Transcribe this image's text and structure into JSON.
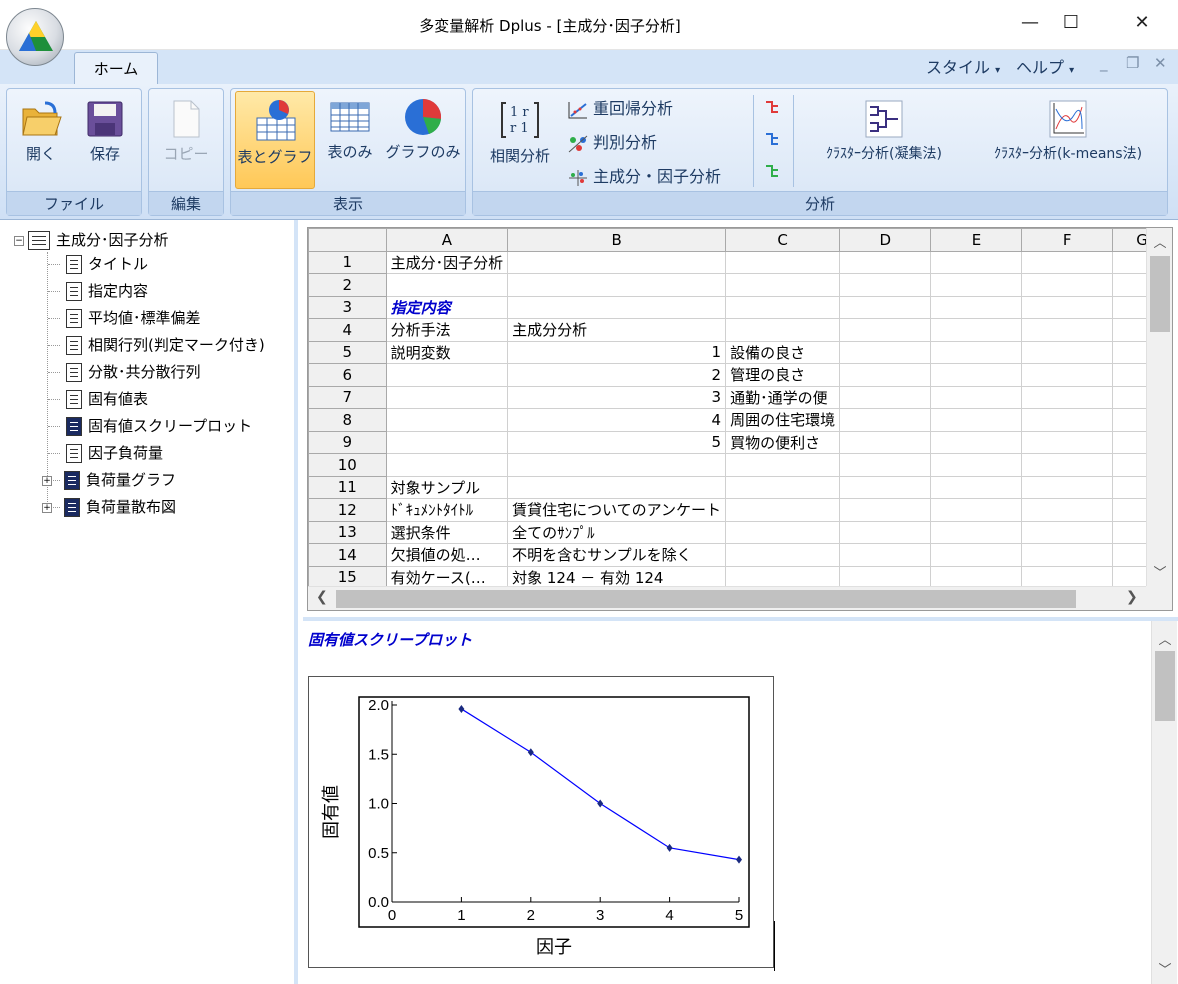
{
  "window": {
    "title": "多変量解析 Dplus - [主成分･因子分析]",
    "controls": {
      "minimize": "—",
      "maximize": "☐",
      "close": "✕"
    }
  },
  "ribbon": {
    "active_tab": "ホーム",
    "right_menus": [
      "スタイル",
      "ヘルプ"
    ],
    "groups": {
      "file": {
        "label": "ファイル",
        "open": "開く",
        "save": "保存"
      },
      "edit": {
        "label": "編集",
        "copy": "コピー"
      },
      "view": {
        "label": "表示",
        "table_and_graph": "表とグラフ",
        "table_only": "表のみ",
        "graph_only": "グラフのみ"
      },
      "analysis": {
        "label": "分析",
        "correlation": "相関分析",
        "regression": "重回帰分析",
        "discriminant": "判別分析",
        "pca_factor": "主成分・因子分析",
        "cluster_hier": "ｸﾗｽﾀｰ分析(凝集法)",
        "cluster_kmeans": "ｸﾗｽﾀｰ分析(k-means法)"
      }
    }
  },
  "tree": {
    "root": "主成分･因子分析",
    "items": [
      {
        "label": "タイトル",
        "dark": false,
        "expandable": false
      },
      {
        "label": "指定内容",
        "dark": false,
        "expandable": false
      },
      {
        "label": "平均値･標準偏差",
        "dark": false,
        "expandable": false
      },
      {
        "label": "相関行列(判定マーク付き)",
        "dark": false,
        "expandable": false
      },
      {
        "label": "分散･共分散行列",
        "dark": false,
        "expandable": false
      },
      {
        "label": "固有値表",
        "dark": false,
        "expandable": false
      },
      {
        "label": "固有値スクリープロット",
        "dark": true,
        "expandable": false
      },
      {
        "label": "因子負荷量",
        "dark": false,
        "expandable": false
      },
      {
        "label": "負荷量グラフ",
        "dark": true,
        "expandable": true
      },
      {
        "label": "負荷量散布図",
        "dark": true,
        "expandable": true
      }
    ]
  },
  "grid": {
    "columns": [
      "A",
      "B",
      "C",
      "D",
      "E",
      "F",
      "G"
    ],
    "rows": [
      {
        "n": "1",
        "a": "主成分･因子分析",
        "b": "",
        "c": ""
      },
      {
        "n": "2",
        "a": "",
        "b": "",
        "c": ""
      },
      {
        "n": "3",
        "a": "指定内容",
        "b": "",
        "c": "",
        "a_style": "blue"
      },
      {
        "n": "4",
        "a": "分析手法",
        "b": "主成分分析",
        "c": ""
      },
      {
        "n": "5",
        "a": "説明変数",
        "b": "1",
        "c": "設備の良さ",
        "b_num": true
      },
      {
        "n": "6",
        "a": "",
        "b": "2",
        "c": "管理の良さ",
        "b_num": true
      },
      {
        "n": "7",
        "a": "",
        "b": "3",
        "c": "通勤･通学の便",
        "b_num": true
      },
      {
        "n": "8",
        "a": "",
        "b": "4",
        "c": "周囲の住宅環境",
        "b_num": true
      },
      {
        "n": "9",
        "a": "",
        "b": "5",
        "c": "買物の便利さ",
        "b_num": true
      },
      {
        "n": "10",
        "a": "",
        "b": "",
        "c": ""
      },
      {
        "n": "11",
        "a": "対象サンプル",
        "b": "",
        "c": ""
      },
      {
        "n": "12",
        "a": "ﾄﾞｷｭﾒﾝﾄﾀｲﾄﾙ",
        "b": "賃貸住宅についてのアンケート",
        "c": ""
      },
      {
        "n": "13",
        "a": "選択条件",
        "b": "全てのｻﾝﾌﾟﾙ",
        "c": ""
      },
      {
        "n": "14",
        "a": "欠損値の処…",
        "b": "不明を含むサンプルを除く",
        "c": ""
      },
      {
        "n": "15",
        "a": "有効ケース(…",
        "b": "対象 124 － 有効 124",
        "c": ""
      }
    ]
  },
  "chart_section": {
    "title": "固有値スクリープロット"
  },
  "chart_data": {
    "type": "line",
    "title": "",
    "xlabel": "因子",
    "ylabel": "固有値",
    "x": [
      1,
      2,
      3,
      4,
      5
    ],
    "series": [
      {
        "values": [
          1.96,
          1.52,
          1.0,
          0.55,
          0.43
        ],
        "color": "#0000ff"
      }
    ],
    "xlim": [
      0,
      5
    ],
    "ylim": [
      0,
      2
    ],
    "xticks": [
      "0",
      "1",
      "2",
      "3",
      "4",
      "5"
    ],
    "yticks": [
      "0.0",
      "0.5",
      "1.0",
      "1.5",
      "2.0"
    ],
    "grid": false
  }
}
